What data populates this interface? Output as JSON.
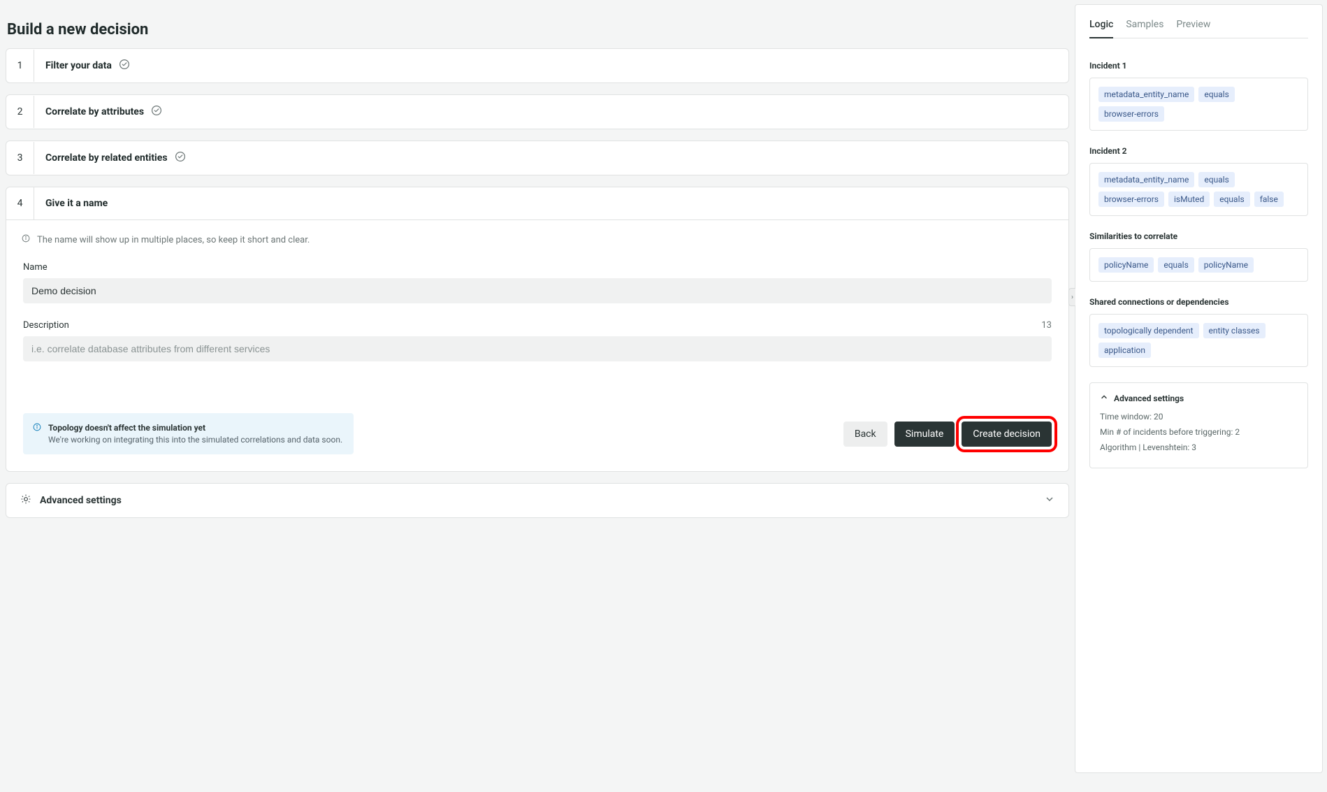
{
  "page": {
    "title": "Build a new decision"
  },
  "steps": [
    {
      "number": "1",
      "label": "Filter your data"
    },
    {
      "number": "2",
      "label": "Correlate by attributes"
    },
    {
      "number": "3",
      "label": "Correlate by related entities"
    },
    {
      "number": "4",
      "label": "Give it a name"
    }
  ],
  "step4": {
    "hint": "The name will show up in multiple places, so keep it short and clear.",
    "name_label": "Name",
    "name_value": "Demo decision",
    "name_counter": "13",
    "desc_label": "Description",
    "desc_placeholder": "i.e. correlate database attributes from different services"
  },
  "notice": {
    "title": "Topology doesn't affect the simulation yet",
    "body": "We're working on integrating this into the simulated correlations and data soon."
  },
  "buttons": {
    "back": "Back",
    "simulate": "Simulate",
    "create": "Create decision"
  },
  "advanced_toggle_label": "Advanced settings",
  "right": {
    "tabs": {
      "logic": "Logic",
      "samples": "Samples",
      "preview": "Preview"
    },
    "incident1": {
      "title": "Incident 1",
      "chips": [
        "metadata_entity_name",
        "equals",
        "browser-errors"
      ]
    },
    "incident2": {
      "title": "Incident 2",
      "chips": [
        "metadata_entity_name",
        "equals",
        "browser-errors",
        "isMuted",
        "equals",
        "false"
      ]
    },
    "similarities": {
      "title": "Similarities to correlate",
      "chips": [
        "policyName",
        "equals",
        "policyName"
      ]
    },
    "shared": {
      "title": "Shared connections or dependencies",
      "chips": [
        "topologically dependent",
        "entity classes",
        "application"
      ]
    },
    "adv": {
      "title": "Advanced settings",
      "time_window": "Time window: 20",
      "min_incidents": "Min # of incidents before triggering: 2",
      "algorithm": "Algorithm | Levenshtein: 3"
    }
  }
}
